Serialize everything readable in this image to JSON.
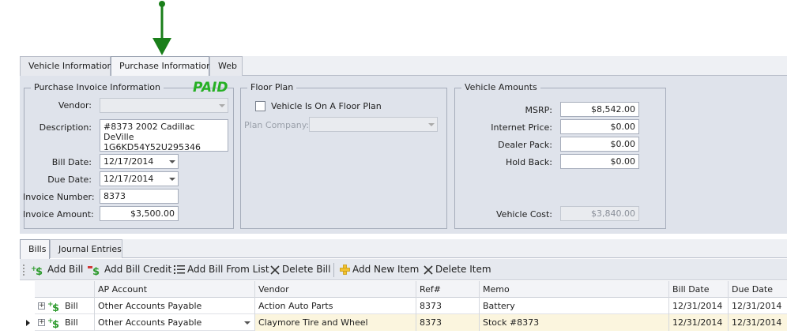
{
  "top_tabs": [
    "Vehicle Information",
    "Purchase Information",
    "Web"
  ],
  "purchase_invoice": {
    "legend": "Purchase Invoice Information",
    "paid_label": "PAID",
    "vendor_label": "Vendor:",
    "vendor_value": "",
    "description_label": "Description:",
    "description_line1": "#8373 2002 Cadillac DeVille",
    "description_line2": "1G6KD54Y52U295346",
    "bill_date_label": "Bill Date:",
    "bill_date_value": "12/17/2014",
    "due_date_label": "Due Date:",
    "due_date_value": "12/17/2014",
    "invoice_number_label": "Invoice Number:",
    "invoice_number_value": "8373",
    "invoice_amount_label": "Invoice Amount:",
    "invoice_amount_value": "$3,500.00"
  },
  "floor_plan": {
    "legend": "Floor Plan",
    "checkbox_label": "Vehicle Is On A Floor Plan",
    "checked": false,
    "plan_company_label": "Plan Company:",
    "plan_company_value": ""
  },
  "vehicle_amounts": {
    "legend": "Vehicle Amounts",
    "msrp_label": "MSRP:",
    "msrp_value": "$8,542.00",
    "internet_price_label": "Internet Price:",
    "internet_price_value": "$0.00",
    "dealer_pack_label": "Dealer Pack:",
    "dealer_pack_value": "$0.00",
    "hold_back_label": "Hold Back:",
    "hold_back_value": "$0.00",
    "vehicle_cost_label": "Vehicle Cost:",
    "vehicle_cost_value": "$3,840.00"
  },
  "lower_tabs": [
    "Bills",
    "Journal Entries"
  ],
  "toolbar": {
    "add_bill": "Add Bill",
    "add_bill_credit": "Add Bill Credit",
    "add_bill_from_list": "Add Bill From List",
    "delete_bill": "Delete Bill",
    "add_new_item": "Add New Item",
    "delete_item": "Delete Item"
  },
  "grid": {
    "columns": [
      "AP Account",
      "Vendor",
      "Ref#",
      "Memo",
      "Bill Date",
      "Due Date"
    ],
    "rows": [
      {
        "type": "Bill",
        "ap_account": "Other Accounts Payable",
        "vendor": "Action Auto Parts",
        "ref": "8373",
        "memo": "Battery",
        "bill_date": "12/31/2014",
        "due_date": "12/31/2014"
      },
      {
        "type": "Bill",
        "ap_account": "Other Accounts Payable",
        "vendor": "Claymore Tire and Wheel",
        "ref": "8373",
        "memo": "Stock #8373",
        "bill_date": "12/31/2014",
        "due_date": "12/31/2014"
      }
    ]
  },
  "colors": {
    "annotation_arrow": "#1a7f1a",
    "paid_green": "#26b024",
    "bill_icon_green": "#2c9a2c",
    "selected_row": "#fbf5de"
  }
}
